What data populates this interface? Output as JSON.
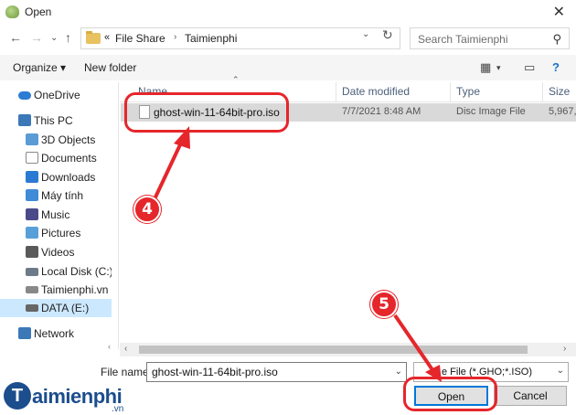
{
  "window": {
    "title": "Open"
  },
  "address": {
    "crumbs": [
      "File Share",
      "Taimienphi"
    ],
    "overflow": "«"
  },
  "search": {
    "placeholder": "Search Taimienphi"
  },
  "toolbar": {
    "organize_label": "Organize ▾",
    "new_folder_label": "New folder"
  },
  "sidebar": {
    "items": [
      {
        "label": "OneDrive",
        "icon": "onedrive-icon",
        "color": "#2b7cd3"
      },
      {
        "label": "This PC",
        "icon": "this-pc-icon",
        "color": "#3b78b8"
      },
      {
        "label": "3D Objects",
        "icon": "3d-objects-icon",
        "color": "#5b9bd5"
      },
      {
        "label": "Documents",
        "icon": "documents-icon",
        "color": "#8a8a8a"
      },
      {
        "label": "Downloads",
        "icon": "downloads-icon",
        "color": "#2a7ad1"
      },
      {
        "label": "Máy tính",
        "icon": "desktop-icon",
        "color": "#3f8bd8"
      },
      {
        "label": "Music",
        "icon": "music-icon",
        "color": "#4a4a8a"
      },
      {
        "label": "Pictures",
        "icon": "pictures-icon",
        "color": "#5aa0d8"
      },
      {
        "label": "Videos",
        "icon": "videos-icon",
        "color": "#5a5a5a"
      },
      {
        "label": "Local Disk (C:)",
        "icon": "local-disk-icon",
        "color": "#6c7a89"
      },
      {
        "label": "Taimienphi.vn (D",
        "icon": "drive-d-icon",
        "color": "#888"
      },
      {
        "label": "DATA (E:)",
        "icon": "drive-e-icon",
        "color": "#666"
      },
      {
        "label": "Network",
        "icon": "network-icon",
        "color": "#3b78b8"
      }
    ]
  },
  "columns": {
    "name": "Name",
    "date": "Date modified",
    "type": "Type",
    "size": "Size"
  },
  "files": [
    {
      "name": "ghost-win-11-64bit-pro.iso",
      "date": "7/7/2021 8:48 AM",
      "type": "Disc Image File",
      "size": "5,967,"
    }
  ],
  "footer": {
    "file_name_label": "File name:",
    "file_name_value": "ghost-win-11-64bit-pro.iso",
    "file_type_value": "e File (*.GHO;*.ISO)",
    "open_label": "Open",
    "cancel_label": "Cancel"
  },
  "annotations": {
    "step4": "4",
    "step5": "5"
  },
  "watermark": {
    "brand": "aimienphi",
    "brand_initial": "T",
    "suffix": ".vn"
  },
  "colors": {
    "annotation": "#e5262b",
    "selection": "#cce8ff",
    "logo": "#1c4d8c"
  }
}
